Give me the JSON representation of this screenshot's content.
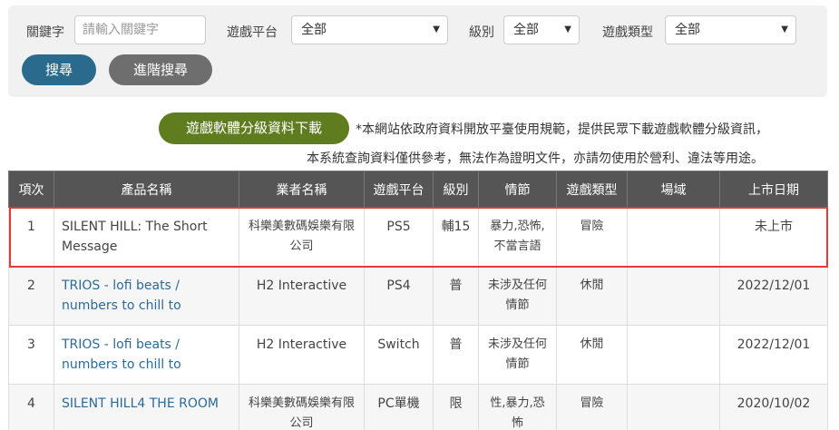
{
  "filters": {
    "keyword_label": "關鍵字",
    "keyword_placeholder": "請輸入關鍵字",
    "platform_label": "遊戲平台",
    "platform_value": "全部",
    "rating_label": "級別",
    "rating_value": "全部",
    "type_label": "遊戲類型",
    "type_value": "全部"
  },
  "buttons": {
    "search": "搜尋",
    "advanced": "進階搜尋",
    "download": "遊戲軟體分級資料下載"
  },
  "notice": {
    "line1": "*本網站依政府資料開放平臺使用規範，提供民眾下載遊戲軟體分級資訊，",
    "line2": "本系統查詢資料僅供參考，無法作為證明文件，亦請勿使用於營利、違法等用途。"
  },
  "table": {
    "headers": [
      "項次",
      "產品名稱",
      "業者名稱",
      "遊戲平台",
      "級別",
      "情節",
      "遊戲類型",
      "場域",
      "上市日期"
    ],
    "rows": [
      {
        "no": "1",
        "name": "SILENT HILL: The Short Message",
        "company": "科樂美數碼娛樂有限公司",
        "platform": "PS5",
        "rating": "輔15",
        "plot": "暴力,恐怖,不當言語",
        "type": "冒險",
        "venue": "",
        "date": "未上市"
      },
      {
        "no": "2",
        "name": "TRIOS - lofi beats / numbers to chill to",
        "company": "H2 Interactive",
        "platform": "PS4",
        "rating": "普",
        "plot": "未涉及任何情節",
        "type": "休閒",
        "venue": "",
        "date": "2022/12/01"
      },
      {
        "no": "3",
        "name": "TRIOS - lofi beats / numbers to chill to",
        "company": "H2 Interactive",
        "platform": "Switch",
        "rating": "普",
        "plot": "未涉及任何情節",
        "type": "休閒",
        "venue": "",
        "date": "2022/12/01"
      },
      {
        "no": "4",
        "name": "SILENT HILL4 THE ROOM",
        "company": "科樂美數碼娛樂有限公司",
        "platform": "PC單機",
        "rating": "限",
        "plot": "性,暴力,恐怖",
        "type": "冒險",
        "venue": "",
        "date": "2020/10/02"
      }
    ]
  },
  "colors": {
    "search_button": "#2a6b8d",
    "advanced_button": "#6e6e6e",
    "download_button": "#5f7d1f",
    "header_bg": "#555555",
    "link": "#2a6b9a",
    "highlight": "#e53935"
  }
}
